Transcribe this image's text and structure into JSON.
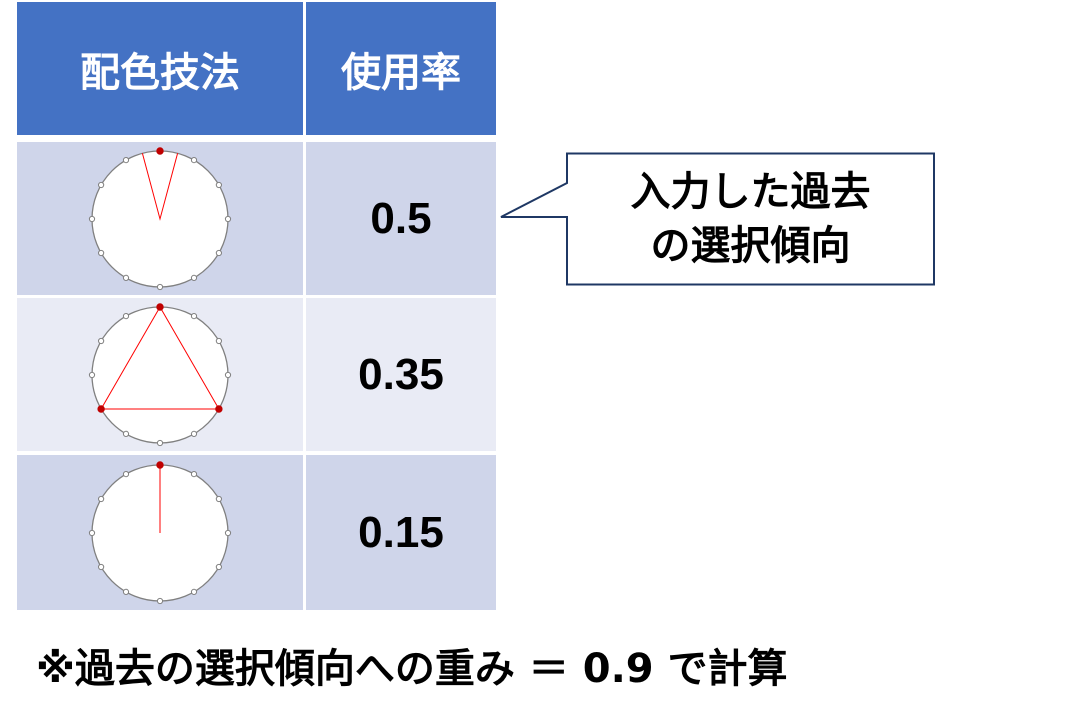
{
  "table": {
    "headers": {
      "method": "配色技法",
      "usage_rate": "使用率"
    },
    "rows": [
      {
        "wheel_icon": "analogous-color-wheel-icon",
        "usage_rate": "0.5"
      },
      {
        "wheel_icon": "triad-color-wheel-icon",
        "usage_rate": "0.35"
      },
      {
        "wheel_icon": "monochrome-color-wheel-icon",
        "usage_rate": "0.15"
      }
    ]
  },
  "callout": {
    "line1": "入力した過去",
    "line2": "の選択傾向"
  },
  "footnote": "※過去の選択傾向への重み ＝ 0.9 で計算",
  "colors": {
    "header_bg": "#4472c4",
    "row_dark": "#cfd5ea",
    "row_light": "#e9ebf5",
    "marker": "#c00000",
    "line": "#ff0000"
  }
}
